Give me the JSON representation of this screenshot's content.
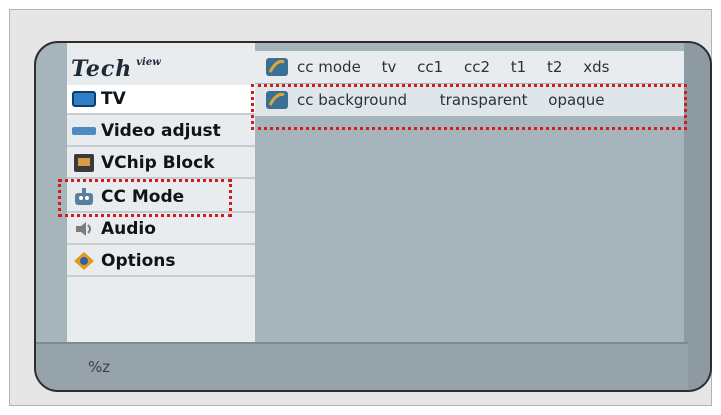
{
  "logo": {
    "main": "Tech",
    "sup": "view"
  },
  "menu": {
    "items": [
      {
        "label": "TV",
        "icon": "tv-icon",
        "selected": true
      },
      {
        "label": "Video adjust",
        "icon": "video-bar-icon",
        "selected": false
      },
      {
        "label": "VChip Block",
        "icon": "vchip-icon",
        "selected": false
      },
      {
        "label": "CC Mode",
        "icon": "cc-robot-icon",
        "selected": false
      },
      {
        "label": "Audio",
        "icon": "audio-icon",
        "selected": false
      },
      {
        "label": "Options",
        "icon": "options-icon",
        "selected": false
      }
    ]
  },
  "options": {
    "rows": [
      {
        "name": "cc mode",
        "values": [
          "tv",
          "cc1",
          "cc2",
          "t1",
          "t2",
          "xds"
        ]
      },
      {
        "name": "cc background",
        "values": [
          "transparent",
          "opaque"
        ]
      }
    ]
  },
  "status": {
    "text": "%z"
  },
  "colors": {
    "highlight": "#d41b1b",
    "screen": "#a6b4bc",
    "panel": "#e9ecef"
  }
}
